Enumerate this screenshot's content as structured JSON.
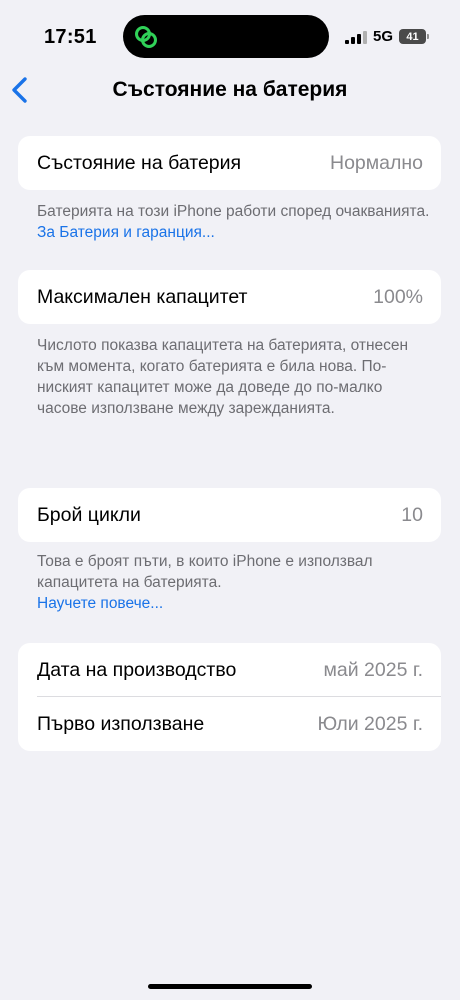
{
  "status": {
    "time": "17:51",
    "network": "5G",
    "battery": "41"
  },
  "nav": {
    "title": "Състояние на батерия",
    "back_icon": "chevron-left-icon"
  },
  "sections": {
    "health": {
      "label": "Състояние на батерия",
      "value": "Нормално",
      "footnote": "Батерията на този iPhone работи според очакванията.",
      "link": "За Батерия и гаранция..."
    },
    "capacity": {
      "label": "Максимален капацитет",
      "value": "100%",
      "footnote": "Числото показва капацитета на батерията, отнесен към момента, когато батерията е била нова. По-ниският капацитет може да доведе до по-малко часове използване между зарежданията."
    },
    "cycles": {
      "label": "Брой цикли",
      "value": "10",
      "footnote": "Това е броят пъти, в които iPhone е използвал капацитета на батерията.",
      "link": "Научете повече..."
    },
    "dates": {
      "manufacture_label": "Дата на производство",
      "manufacture_value": "май 2025 г.",
      "first_use_label": "Първо използване",
      "first_use_value": "Юли 2025 г."
    }
  },
  "colors": {
    "background": "#f1f1f6",
    "accent": "#1a73e8",
    "secondary_text": "#8a8a8e"
  }
}
